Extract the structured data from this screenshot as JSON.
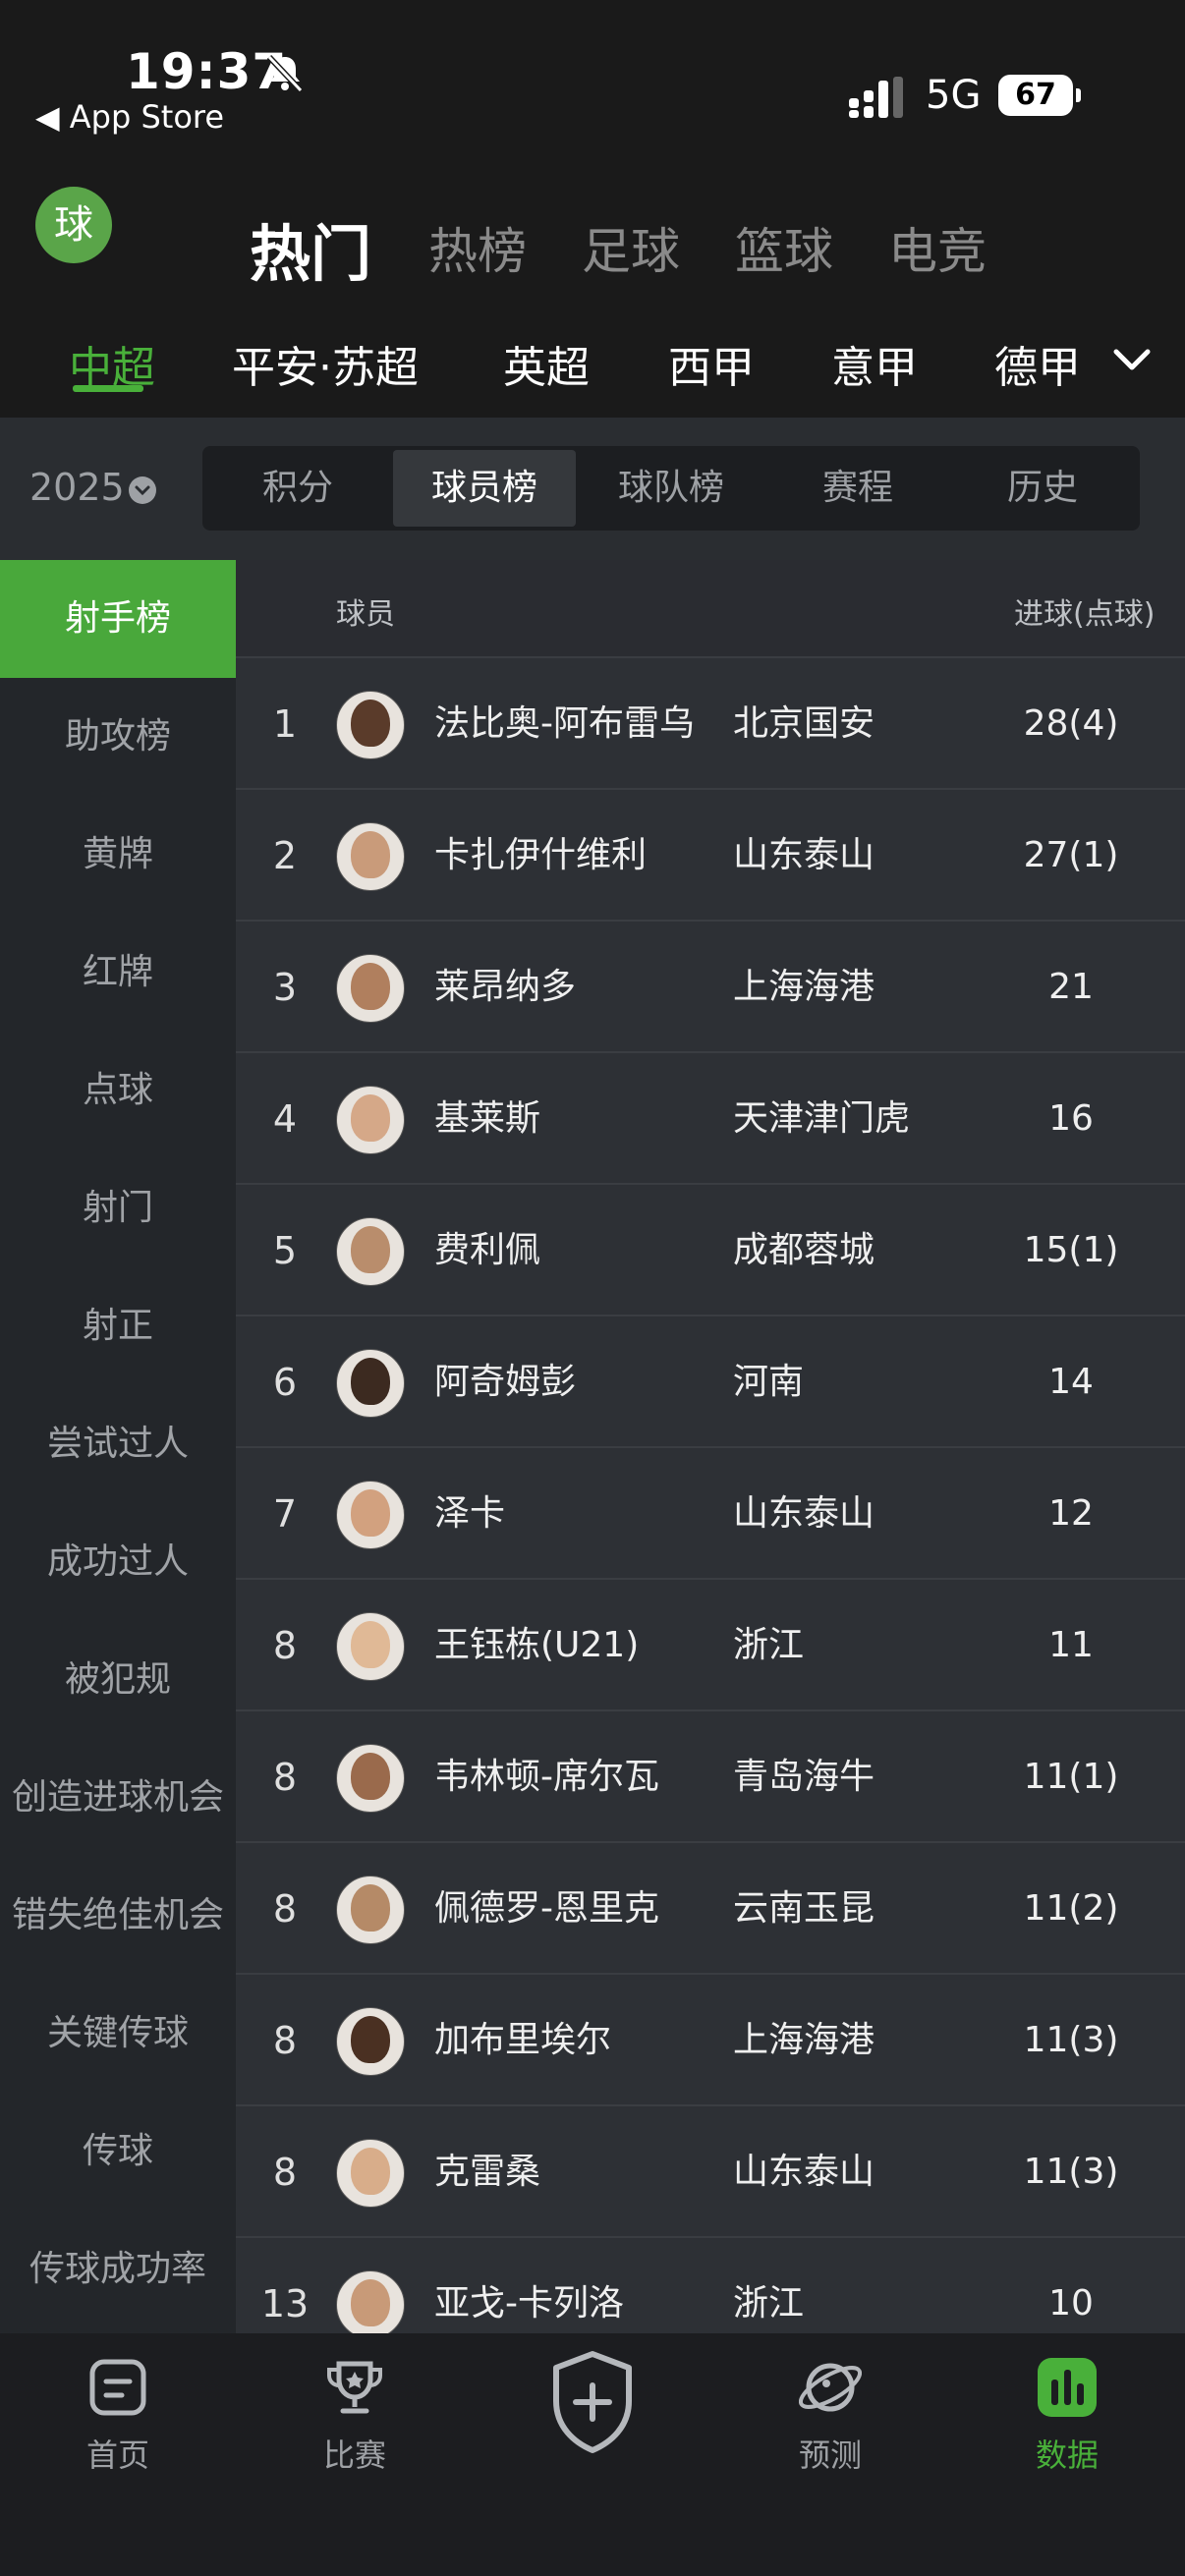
{
  "status_bar": {
    "time": "19:37",
    "back_label": "◀ App Store",
    "network": "5G",
    "battery": "67"
  },
  "header": {
    "logo_text": "球",
    "top_tabs": [
      {
        "label": "热门",
        "active": true
      },
      {
        "label": "热榜"
      },
      {
        "label": "足球"
      },
      {
        "label": "篮球"
      },
      {
        "label": "电竞"
      }
    ],
    "leagues": [
      {
        "label": "中超",
        "active": true
      },
      {
        "label": "平安·苏超"
      },
      {
        "label": "英超"
      },
      {
        "label": "西甲"
      },
      {
        "label": "意甲"
      },
      {
        "label": "德甲"
      }
    ]
  },
  "season": "2025",
  "segments": [
    {
      "label": "积分"
    },
    {
      "label": "球员榜",
      "active": true
    },
    {
      "label": "球队榜"
    },
    {
      "label": "赛程"
    },
    {
      "label": "历史"
    }
  ],
  "sidebar": [
    {
      "label": "射手榜",
      "active": true
    },
    {
      "label": "助攻榜"
    },
    {
      "label": "黄牌"
    },
    {
      "label": "红牌"
    },
    {
      "label": "点球"
    },
    {
      "label": "射门"
    },
    {
      "label": "射正"
    },
    {
      "label": "尝试过人"
    },
    {
      "label": "成功过人"
    },
    {
      "label": "被犯规"
    },
    {
      "label": "创造进球机会"
    },
    {
      "label": "错失绝佳机会"
    },
    {
      "label": "关键传球"
    },
    {
      "label": "传球"
    },
    {
      "label": "传球成功率"
    }
  ],
  "table": {
    "headers": {
      "player": "球员",
      "goals": "进球(点球)"
    },
    "rows": [
      {
        "rank": "1",
        "name": "法比奥-阿布雷乌",
        "team": "北京国安",
        "goals": "28(4)"
      },
      {
        "rank": "2",
        "name": "卡扎伊什维利",
        "team": "山东泰山",
        "goals": "27(1)"
      },
      {
        "rank": "3",
        "name": "莱昂纳多",
        "team": "上海海港",
        "goals": "21"
      },
      {
        "rank": "4",
        "name": "基莱斯",
        "team": "天津津门虎",
        "goals": "16"
      },
      {
        "rank": "5",
        "name": "费利佩",
        "team": "成都蓉城",
        "goals": "15(1)"
      },
      {
        "rank": "6",
        "name": "阿奇姆彭",
        "team": "河南",
        "goals": "14"
      },
      {
        "rank": "7",
        "name": "泽卡",
        "team": "山东泰山",
        "goals": "12"
      },
      {
        "rank": "8",
        "name": "王钰栋(U21)",
        "team": "浙江",
        "goals": "11"
      },
      {
        "rank": "8",
        "name": "韦林顿-席尔瓦",
        "team": "青岛海牛",
        "goals": "11(1)"
      },
      {
        "rank": "8",
        "name": "佩德罗-恩里克",
        "team": "云南玉昆",
        "goals": "11(2)"
      },
      {
        "rank": "8",
        "name": "加布里埃尔",
        "team": "上海海港",
        "goals": "11(3)"
      },
      {
        "rank": "8",
        "name": "克雷桑",
        "team": "山东泰山",
        "goals": "11(3)"
      },
      {
        "rank": "13",
        "name": "亚戈-卡列洛",
        "team": "浙江",
        "goals": "10"
      }
    ]
  },
  "bottom_nav": [
    {
      "label": "首页",
      "icon": "home-doc-icon"
    },
    {
      "label": "比赛",
      "icon": "trophy-icon"
    },
    {
      "label": "",
      "icon": "shield-plus-icon"
    },
    {
      "label": "预测",
      "icon": "planet-icon"
    },
    {
      "label": "数据",
      "icon": "bar-chart-icon",
      "active": true
    }
  ],
  "colors": {
    "accent": "#49b03a",
    "background": "#1b1d20",
    "row_bg": "#2d3035"
  }
}
